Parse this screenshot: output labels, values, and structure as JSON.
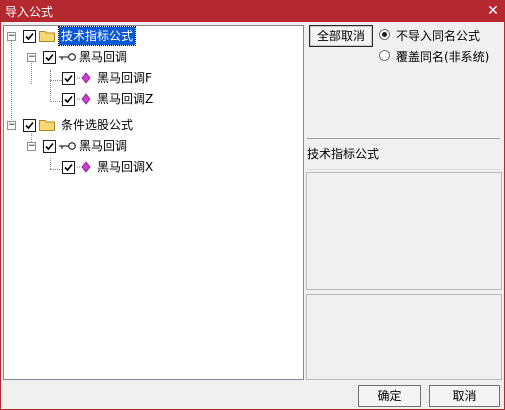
{
  "window": {
    "title": "导入公式",
    "close_glyph": "✕"
  },
  "tree": {
    "nodes": [
      {
        "label": "技术指标公式",
        "checked": true,
        "expanded": true,
        "selected": true,
        "icon": "folder-icon"
      },
      {
        "label": "黑马回调",
        "checked": true,
        "expanded": true,
        "icon": "key-icon"
      },
      {
        "label": "黑马回调F",
        "checked": true,
        "icon": "formula-diamond-icon"
      },
      {
        "label": "黑马回调Z",
        "checked": true,
        "icon": "formula-diamond-icon"
      },
      {
        "label": "条件选股公式",
        "checked": true,
        "expanded": true,
        "icon": "folder-icon"
      },
      {
        "label": "黑马回调",
        "checked": true,
        "expanded": true,
        "icon": "key-icon"
      },
      {
        "label": "黑马回调X",
        "checked": true,
        "icon": "formula-diamond-icon"
      }
    ],
    "expand_glyph": "−"
  },
  "right": {
    "deselect_all_label": "全部取消",
    "options": [
      {
        "label": "不导入同名公式",
        "selected": true
      },
      {
        "label": "覆盖同名(非系统)",
        "selected": false
      }
    ],
    "category_label": "技术指标公式"
  },
  "footer": {
    "ok_label": "确定",
    "cancel_label": "取消"
  },
  "colors": {
    "title_bar": "#b5282f",
    "selection": "#0a58d6",
    "diamond": "#d23ad6"
  }
}
